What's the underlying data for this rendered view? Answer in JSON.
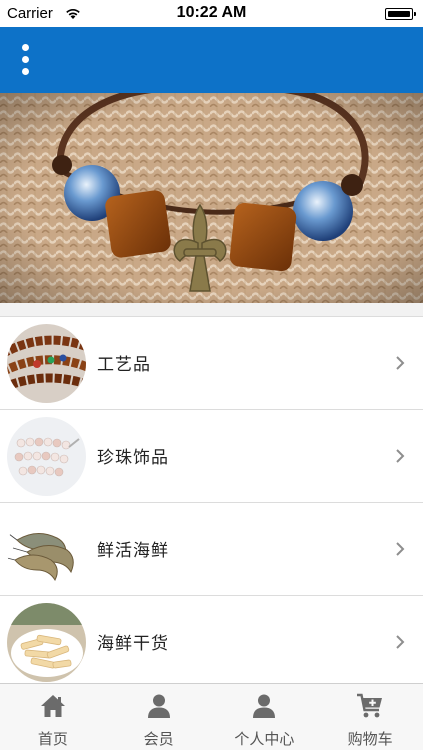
{
  "status_bar": {
    "carrier": "Carrier",
    "time": "10:22 AM"
  },
  "nav": {
    "menu_icon": "vertical-dots-icon"
  },
  "banner": {
    "image": "bracelet-photo"
  },
  "categories": [
    {
      "label": "工艺品",
      "thumb": "wooden-beads-photo"
    },
    {
      "label": "珍珠饰品",
      "thumb": "pearl-necklace-photo"
    },
    {
      "label": "鲜活海鲜",
      "thumb": "shrimp-photo"
    },
    {
      "label": "海鲜干货",
      "thumb": "dried-seafood-photo"
    }
  ],
  "tabs": [
    {
      "label": "首页",
      "icon": "home-icon"
    },
    {
      "label": "会员",
      "icon": "user-icon"
    },
    {
      "label": "个人中心",
      "icon": "user-center-icon"
    },
    {
      "label": "购物车",
      "icon": "cart-add-icon"
    }
  ],
  "colors": {
    "nav": "#0d72c8",
    "tab_icon": "#6b6b6b"
  }
}
